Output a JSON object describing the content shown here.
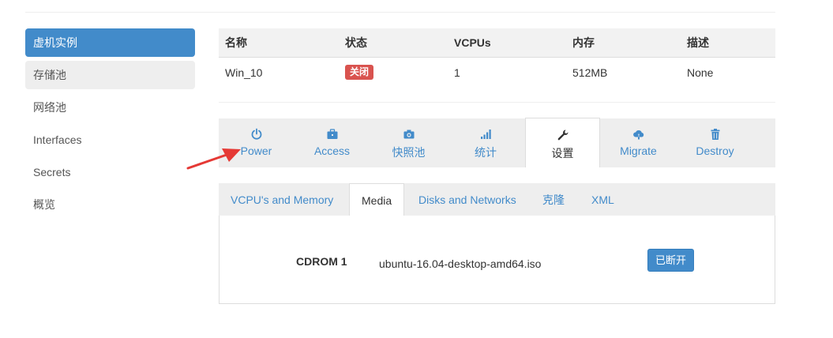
{
  "sidebar": {
    "items": [
      {
        "label": "虚机实例"
      },
      {
        "label": "存储池"
      },
      {
        "label": "网络池"
      },
      {
        "label": "Interfaces"
      },
      {
        "label": "Secrets"
      },
      {
        "label": "概览"
      }
    ]
  },
  "table": {
    "headers": [
      "名称",
      "状态",
      "VCPUs",
      "内存",
      "描述"
    ],
    "row": {
      "name": "Win_10",
      "status": "关闭",
      "vcpus": "1",
      "memory": "512MB",
      "description": "None"
    }
  },
  "actions": [
    {
      "label": "Power",
      "icon": "power-icon"
    },
    {
      "label": "Access",
      "icon": "briefcase-icon"
    },
    {
      "label": "快照池",
      "icon": "camera-icon"
    },
    {
      "label": "统计",
      "icon": "signal-icon"
    },
    {
      "label": "设置",
      "icon": "wrench-icon"
    },
    {
      "label": "Migrate",
      "icon": "cloud-upload-icon"
    },
    {
      "label": "Destroy",
      "icon": "trash-icon"
    }
  ],
  "subtabs": [
    {
      "label": "VCPU's and Memory"
    },
    {
      "label": "Media"
    },
    {
      "label": "Disks and Networks"
    },
    {
      "label": "克隆"
    },
    {
      "label": "XML"
    }
  ],
  "media": {
    "cdrom_label": "CDROM 1",
    "cdrom_value": "ubuntu-16.04-desktop-amd64.iso",
    "disconnect_label": "已断开"
  },
  "colors": {
    "primary": "#428bca",
    "danger": "#d9534f",
    "annotation": "#e53935"
  }
}
